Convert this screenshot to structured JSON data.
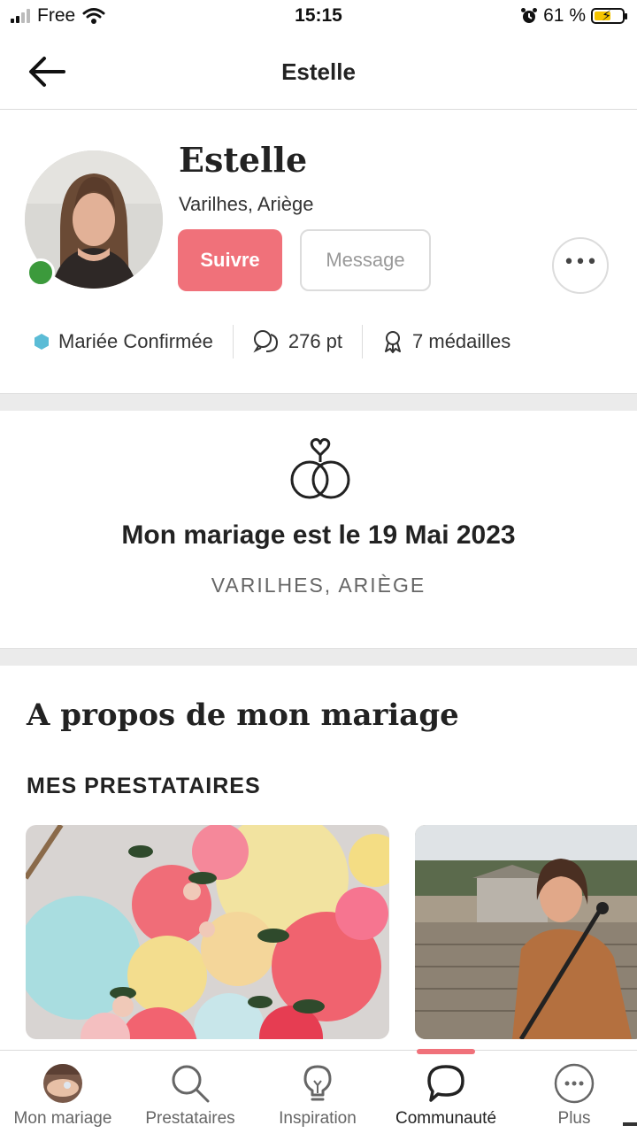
{
  "status_bar": {
    "carrier": "Free",
    "time": "15:15",
    "battery_percent": "61 %",
    "battery_level": 0.61
  },
  "nav": {
    "title": "Estelle"
  },
  "profile": {
    "name": "Estelle",
    "location": "Varilhes, Ariège",
    "follow_label": "Suivre",
    "message_label": "Message",
    "more_label": "•••",
    "online": true,
    "stats": {
      "status": "Mariée Confirmée",
      "points": "276 pt",
      "medals": "7 médailles"
    }
  },
  "wedding": {
    "date_text": "Mon mariage est le 19 Mai 2023",
    "place": "VARILHES, ARIÈGE"
  },
  "about": {
    "title": "A propos de mon mariage",
    "providers_heading": "MES PRESTATAIRES"
  },
  "tabs": [
    {
      "label": "Mon mariage",
      "icon": "avatar-photo"
    },
    {
      "label": "Prestataires",
      "icon": "search-icon"
    },
    {
      "label": "Inspiration",
      "icon": "lightbulb-icon"
    },
    {
      "label": "Communauté",
      "icon": "speech-bubble-icon",
      "active": true
    },
    {
      "label": "Plus",
      "icon": "more-icon"
    }
  ],
  "colors": {
    "accent": "#f0717a",
    "online": "#3c9a3c",
    "badge": "#5bbcd6"
  }
}
